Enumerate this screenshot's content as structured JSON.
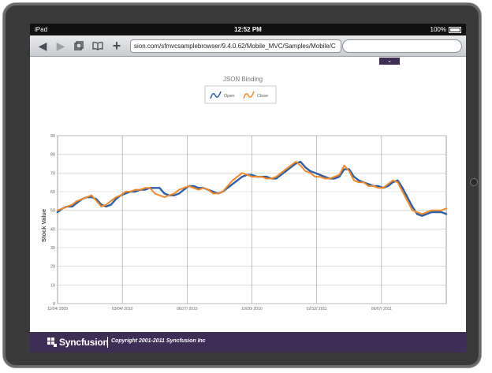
{
  "status": {
    "device": "iPad",
    "time": "12:52 PM",
    "battery": "100%"
  },
  "browser": {
    "url": "sion.com/sfmvcsamplebrowser/9.4.0.62/Mobile_MVC/Samples/Mobile/C",
    "back_icon": "back-arrow-icon",
    "forward_icon": "forward-arrow-icon",
    "tabs_icon": "tabs-icon",
    "bookmarks_icon": "book-icon",
    "add_icon": "plus-icon"
  },
  "footer": {
    "brand": "Syncfusion",
    "copyright": "Copyright 2001-2011 Syncfusion Inc"
  },
  "chart_data": {
    "type": "line",
    "title": "JSON Binding",
    "ylabel": "Stock Value",
    "xlabel": "",
    "ylim": [
      0,
      90
    ],
    "yticks": [
      0,
      10,
      20,
      30,
      40,
      50,
      60,
      70,
      80,
      90
    ],
    "xlim": [
      0,
      120
    ],
    "xtick_positions": [
      0,
      20,
      40,
      60,
      80,
      100,
      120
    ],
    "xtick_labels": [
      "11/04/ 2009",
      "03/04/ 2010",
      "06/27/ 2010",
      "10/20/ 2010",
      "02/12/ 2011",
      "06/07/ 2011",
      ""
    ],
    "grid": true,
    "legend_position": "top-center",
    "colors": {
      "Open": "#2f5fa8",
      "Close": "#f28a2a"
    },
    "series": [
      {
        "name": "Open",
        "values": [
          49,
          51,
          52,
          52,
          54,
          56,
          57,
          57,
          56,
          53,
          52,
          53,
          56,
          58,
          59,
          60,
          60,
          61,
          61,
          62,
          62,
          62,
          59,
          58,
          58,
          59,
          61,
          63,
          63,
          62,
          62,
          61,
          60,
          59,
          60,
          62,
          64,
          66,
          68,
          69,
          69,
          68,
          68,
          68,
          67,
          67,
          69,
          71,
          73,
          75,
          76,
          73,
          71,
          70,
          69,
          68,
          67,
          67,
          68,
          72,
          72,
          68,
          66,
          65,
          64,
          63,
          63,
          62,
          63,
          65,
          66,
          62,
          57,
          52,
          48,
          47,
          48,
          49,
          49,
          49,
          48
        ]
      },
      {
        "name": "Close",
        "values": [
          50,
          51,
          52,
          53,
          55,
          56,
          57,
          58,
          55,
          52,
          53,
          55,
          57,
          58,
          60,
          60,
          61,
          61,
          62,
          62,
          59,
          58,
          57,
          58,
          59,
          61,
          62,
          63,
          62,
          61,
          62,
          61,
          59,
          59,
          60,
          63,
          66,
          68,
          70,
          69,
          68,
          68,
          68,
          67,
          67,
          68,
          70,
          72,
          74,
          76,
          74,
          71,
          70,
          68,
          68,
          67,
          67,
          68,
          69,
          74,
          71,
          66,
          65,
          65,
          63,
          63,
          62,
          62,
          64,
          66,
          65,
          60,
          55,
          50,
          49,
          48,
          49,
          50,
          50,
          50,
          51
        ]
      }
    ]
  }
}
